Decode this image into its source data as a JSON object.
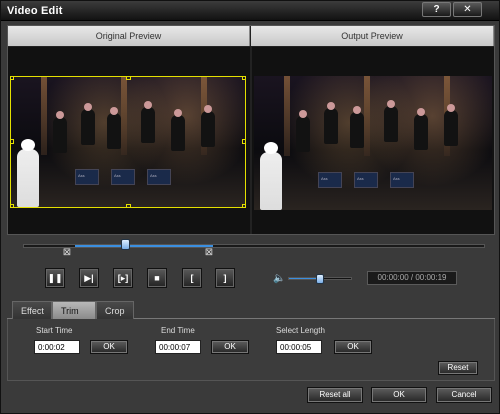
{
  "window": {
    "title": "Video Edit",
    "help": "?",
    "close": "✕"
  },
  "preview": {
    "original_title": "Original Preview",
    "output_title": "Output Preview",
    "stand_text": "Ass"
  },
  "timeline": {
    "trim_start_marker": "⊠",
    "trim_end_marker": "⊠",
    "selection_start_fraction": 0.11,
    "selection_end_fraction": 0.41,
    "playhead_fraction": 0.22,
    "volume_fraction": 0.5,
    "time_readout": "00:00:00 / 00:00:19"
  },
  "controls": {
    "pause": "❚❚",
    "next_frame": "▶|",
    "play_selection": "[▸]",
    "stop": "■",
    "mark_in": "[",
    "mark_out": "]",
    "volume_icon": "🔈"
  },
  "tabs": [
    {
      "label": "Effect",
      "active": false
    },
    {
      "label": "Trim",
      "active": true
    },
    {
      "label": "Crop",
      "active": false
    }
  ],
  "trim": {
    "start_label": "Start Time",
    "start_value": "0:00:02",
    "end_label": "End Time",
    "end_value": "00:00:07",
    "length_label": "Select Length",
    "length_value": "00:00:05",
    "ok_label": "OK",
    "reset_label": "Reset"
  },
  "footer": {
    "reset_all": "Reset all",
    "ok": "OK",
    "cancel": "Cancel"
  },
  "colors": {
    "accent": "#3b8fe0",
    "crop_border": "#e4e000"
  }
}
